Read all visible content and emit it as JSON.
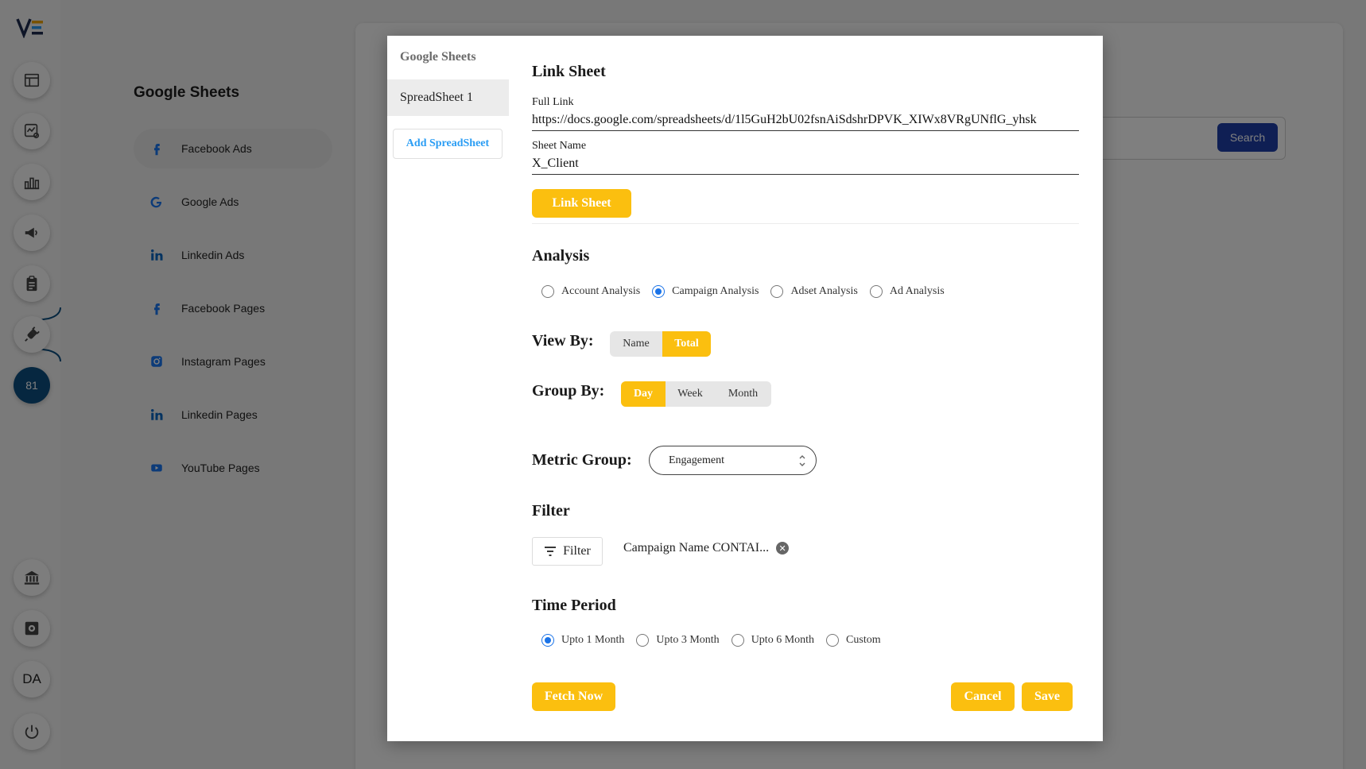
{
  "rail": {
    "badge_count": "81",
    "user_initials": "DA"
  },
  "nav": {
    "title": "Google Sheets",
    "items": [
      {
        "label": "Facebook Ads",
        "icon": "facebook-icon"
      },
      {
        "label": "Google Ads",
        "icon": "google-icon"
      },
      {
        "label": "Linkedin Ads",
        "icon": "linkedin-icon"
      },
      {
        "label": "Facebook Pages",
        "icon": "facebook-icon"
      },
      {
        "label": "Instagram Pages",
        "icon": "instagram-icon"
      },
      {
        "label": "Linkedin Pages",
        "icon": "linkedin-icon"
      },
      {
        "label": "YouTube Pages",
        "icon": "youtube-icon"
      }
    ]
  },
  "header": {
    "search_label": "Search"
  },
  "modal": {
    "sidebar": {
      "title": "Google Sheets",
      "sheet_label": "SpreadSheet 1",
      "add_label": "Add SpreadSheet"
    },
    "link_sheet": {
      "heading": "Link Sheet",
      "full_link_label": "Full Link",
      "full_link_value": "https://docs.google.com/spreadsheets/d/1l5GuH2bU02fsnAiSdshrDPVK_XIWx8VRgUNflG_yhsk",
      "sheet_name_label": "Sheet Name",
      "sheet_name_value": "X_Client",
      "button_label": "Link Sheet"
    },
    "analysis": {
      "heading": "Analysis",
      "options": [
        "Account Analysis",
        "Campaign Analysis",
        "Adset Analysis",
        "Ad Analysis"
      ],
      "selected": "Campaign Analysis"
    },
    "view_by": {
      "heading": "View By:",
      "options": [
        "Name",
        "Total"
      ],
      "selected": "Total"
    },
    "group_by": {
      "heading": "Group By:",
      "options": [
        "Day",
        "Week",
        "Month"
      ],
      "selected": "Day"
    },
    "metric_group": {
      "heading": "Metric Group:",
      "value": "Engagement"
    },
    "filter": {
      "heading": "Filter",
      "button_label": "Filter",
      "chip_label": "Campaign Name CONTAI..."
    },
    "time_period": {
      "heading": "Time Period",
      "options": [
        "Upto 1 Month",
        "Upto 3 Month",
        "Upto 6 Month",
        "Custom"
      ],
      "selected": "Upto 1 Month"
    },
    "actions": {
      "fetch_label": "Fetch Now",
      "cancel_label": "Cancel",
      "save_label": "Save"
    }
  },
  "colors": {
    "accent_yellow": "#fbbf0f",
    "radio_blue": "#1a73e8",
    "search_blue": "#1e3fa8",
    "link_blue": "#2a9df4"
  }
}
